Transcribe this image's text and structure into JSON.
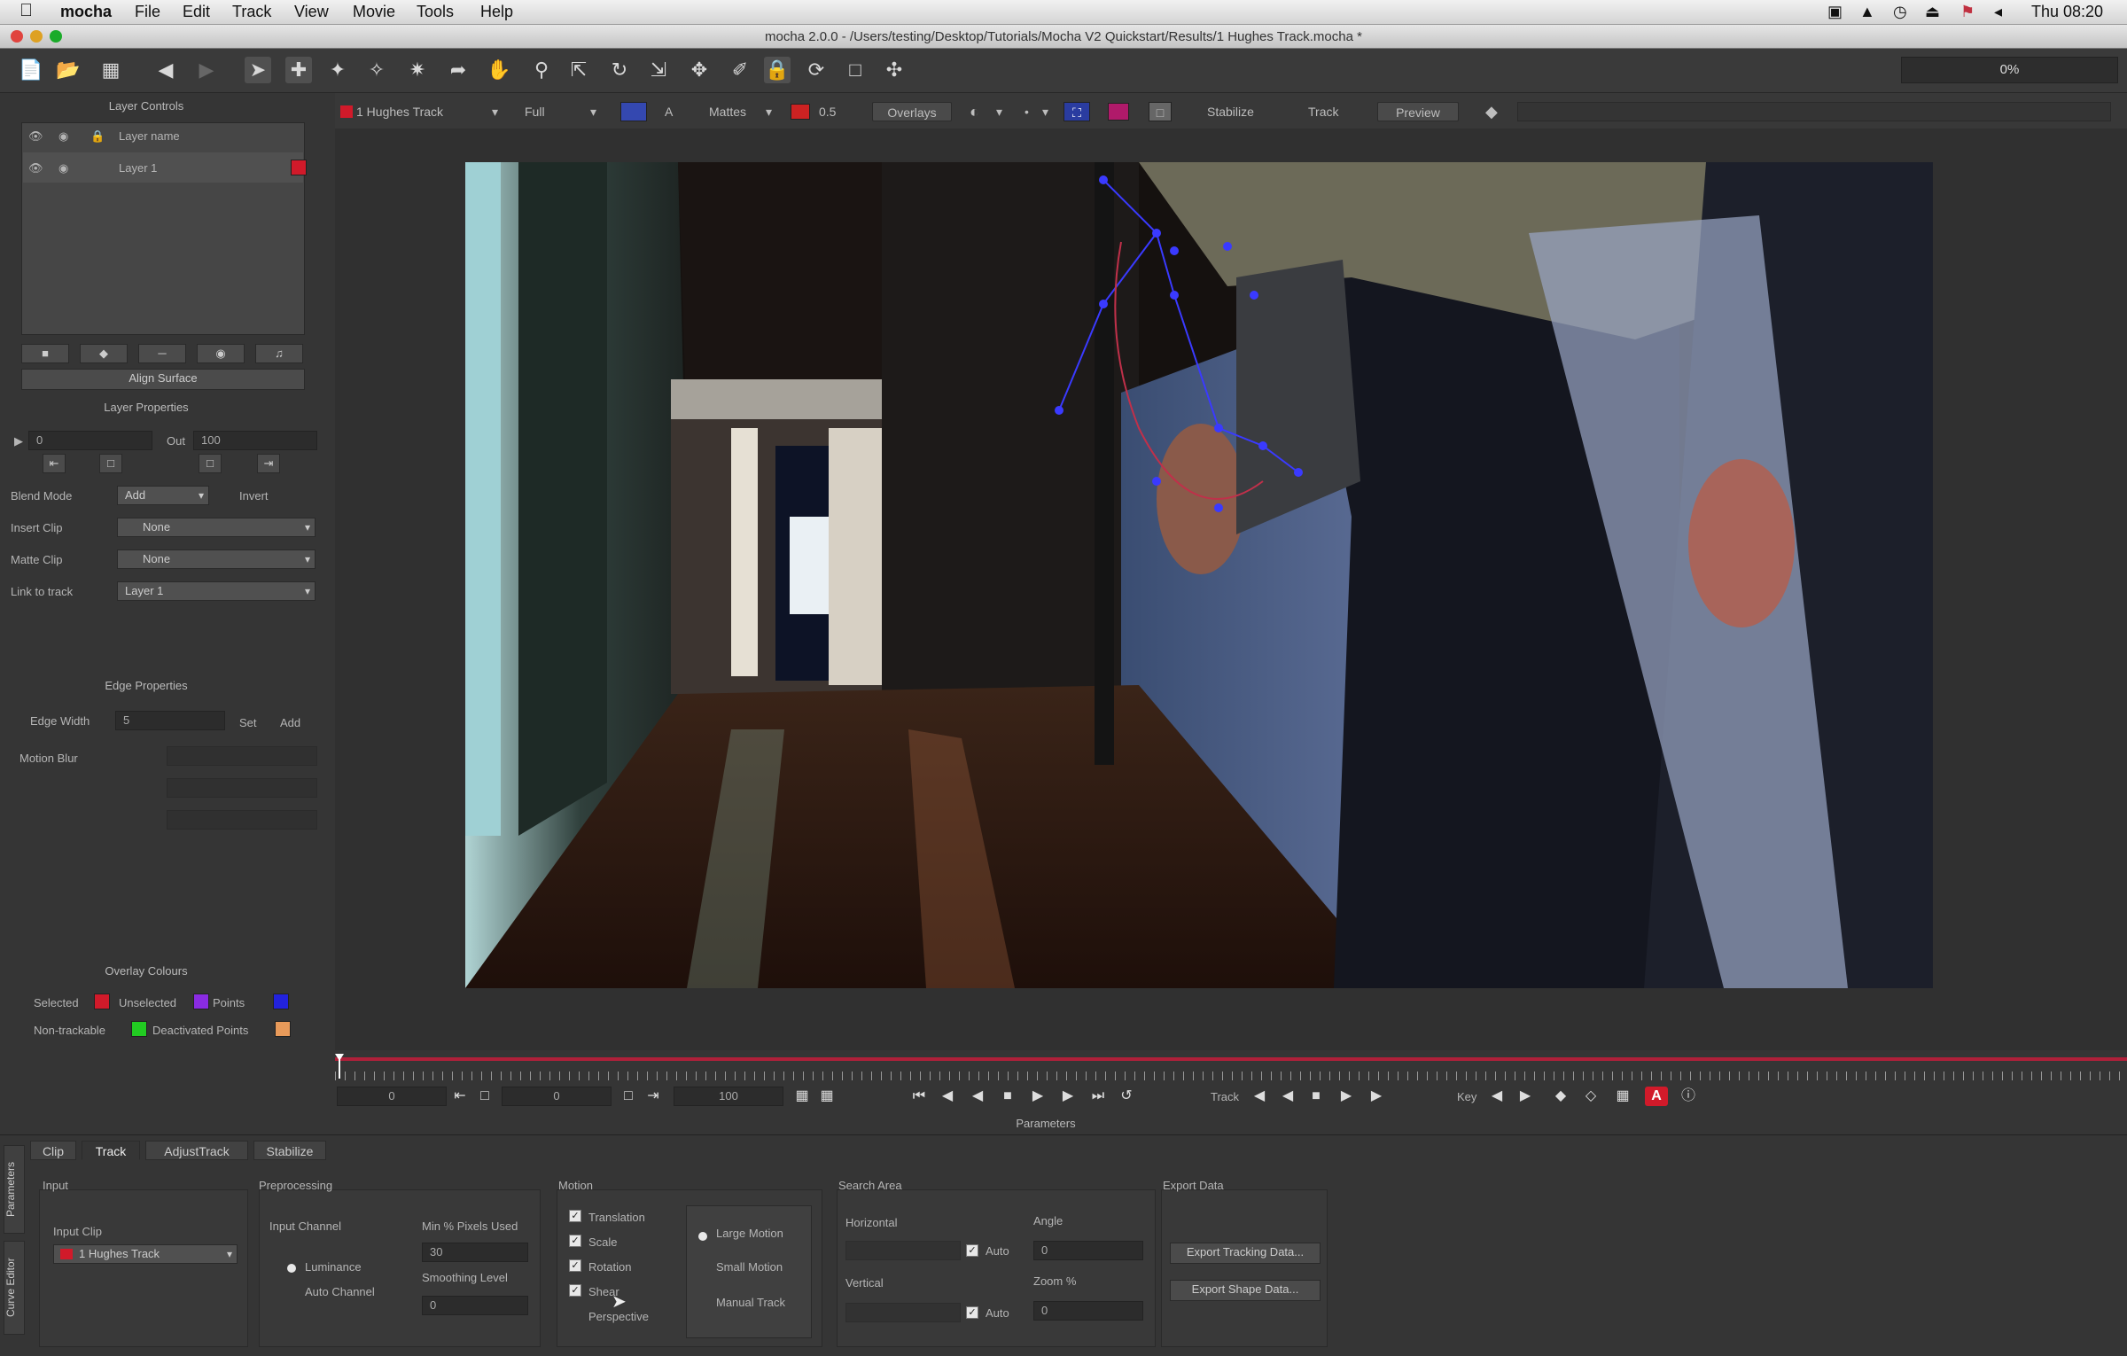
{
  "menubar": {
    "apple": "",
    "app": "mocha",
    "items": [
      "File",
      "Edit",
      "Track",
      "View",
      "Movie",
      "Tools",
      "Help"
    ],
    "clock": "Thu 08:20"
  },
  "window": {
    "title": "mocha 2.0.0 - /Users/testing/Desktop/Tutorials/Mocha V2 Quickstart/Results/1 Hughes Track.mocha *"
  },
  "toolbar": {
    "progress": "0%",
    "icons": [
      "new-file-icon",
      "open-file-icon",
      "save-icon",
      "undo-icon",
      "redo-icon",
      "pick-tool-icon",
      "add-x-spline-icon",
      "add-point-icon",
      "add-edge-icon",
      "add-bezier-icon",
      "select-cursor-icon",
      "hand-icon",
      "zoom-icon",
      "transform-icon",
      "rotate-icon",
      "scale-icon",
      "move-icon",
      "pen-icon",
      "lock-icon",
      "refresh-icon",
      "surface-icon",
      "crosshair-icon"
    ]
  },
  "viewer_toolbar": {
    "clip": "1 Hughes Track",
    "resolution": "Full",
    "channel_a": "A",
    "matte": "Mattes",
    "value": "0.5",
    "overlays": "Overlays",
    "stabilize": "Stabilize",
    "track": "Track",
    "preview": "Preview"
  },
  "layer_controls": {
    "title": "Layer Controls",
    "column_header": "Layer name",
    "layers": [
      {
        "name": "Layer 1",
        "color": "#d11a2a"
      }
    ],
    "align_surface": "Align Surface"
  },
  "layer_properties": {
    "title": "Layer Properties",
    "in_value": "0",
    "out_label": "Out",
    "out_value": "100",
    "blend_mode_label": "Blend Mode",
    "blend_mode_value": "Add",
    "invert_label": "Invert",
    "insert_clip_label": "Insert Clip",
    "insert_clip_value": "None",
    "matte_clip_label": "Matte Clip",
    "matte_clip_value": "None",
    "link_to_track_label": "Link to track",
    "link_to_track_value": "Layer 1"
  },
  "edge_properties": {
    "title": "Edge Properties",
    "edge_width_label": "Edge Width",
    "edge_width_value": "5",
    "set_label": "Set",
    "add_label": "Add",
    "motion_blur_label": "Motion Blur"
  },
  "overlay_colours": {
    "title": "Overlay Colours",
    "selected_label": "Selected",
    "selected_color": "#d11a2a",
    "unselected_label": "Unselected",
    "unselected_color": "#8a2be2",
    "points_label": "Points",
    "points_color": "#2222dd",
    "non_trackable_label": "Non-trackable",
    "non_trackable_color": "#22cc22",
    "deactivated_label": "Deactivated Points",
    "deactivated_color": "#e89a5a"
  },
  "timeline": {
    "in_frame": "0",
    "current_frame": "0",
    "out_frame": "100",
    "track_label": "Track",
    "key_label": "Key",
    "key_badge": "A"
  },
  "parameters": {
    "title": "Parameters",
    "side_tabs": [
      "Parameters",
      "Curve Editor"
    ],
    "tabs": [
      "Clip",
      "Track",
      "AdjustTrack",
      "Stabilize"
    ],
    "active_tab": "Track",
    "input": {
      "title": "Input",
      "input_clip_label": "Input Clip",
      "input_clip_value": "1 Hughes Track"
    },
    "preprocessing": {
      "title": "Preprocessing",
      "input_channel_label": "Input Channel",
      "luminance": "Luminance",
      "auto_channel": "Auto Channel",
      "min_pixels_label": "Min % Pixels Used",
      "min_pixels_value": "30",
      "smoothing_label": "Smoothing Level",
      "smoothing_value": "0"
    },
    "motion": {
      "title": "Motion",
      "options": [
        {
          "label": "Translation",
          "checked": true
        },
        {
          "label": "Scale",
          "checked": true
        },
        {
          "label": "Rotation",
          "checked": true
        },
        {
          "label": "Shear",
          "checked": true
        },
        {
          "label": "Perspective",
          "checked": false
        }
      ],
      "large_motion": "Large Motion",
      "small_motion": "Small Motion",
      "manual_track": "Manual Track"
    },
    "search_area": {
      "title": "Search Area",
      "horizontal_label": "Horizontal",
      "vertical_label": "Vertical",
      "auto_label": "Auto",
      "angle_label": "Angle",
      "angle_value": "0",
      "zoom_label": "Zoom %",
      "zoom_value": "0"
    },
    "export_data": {
      "title": "Export Data",
      "export_tracking": "Export Tracking Data...",
      "export_shape": "Export Shape Data..."
    }
  }
}
